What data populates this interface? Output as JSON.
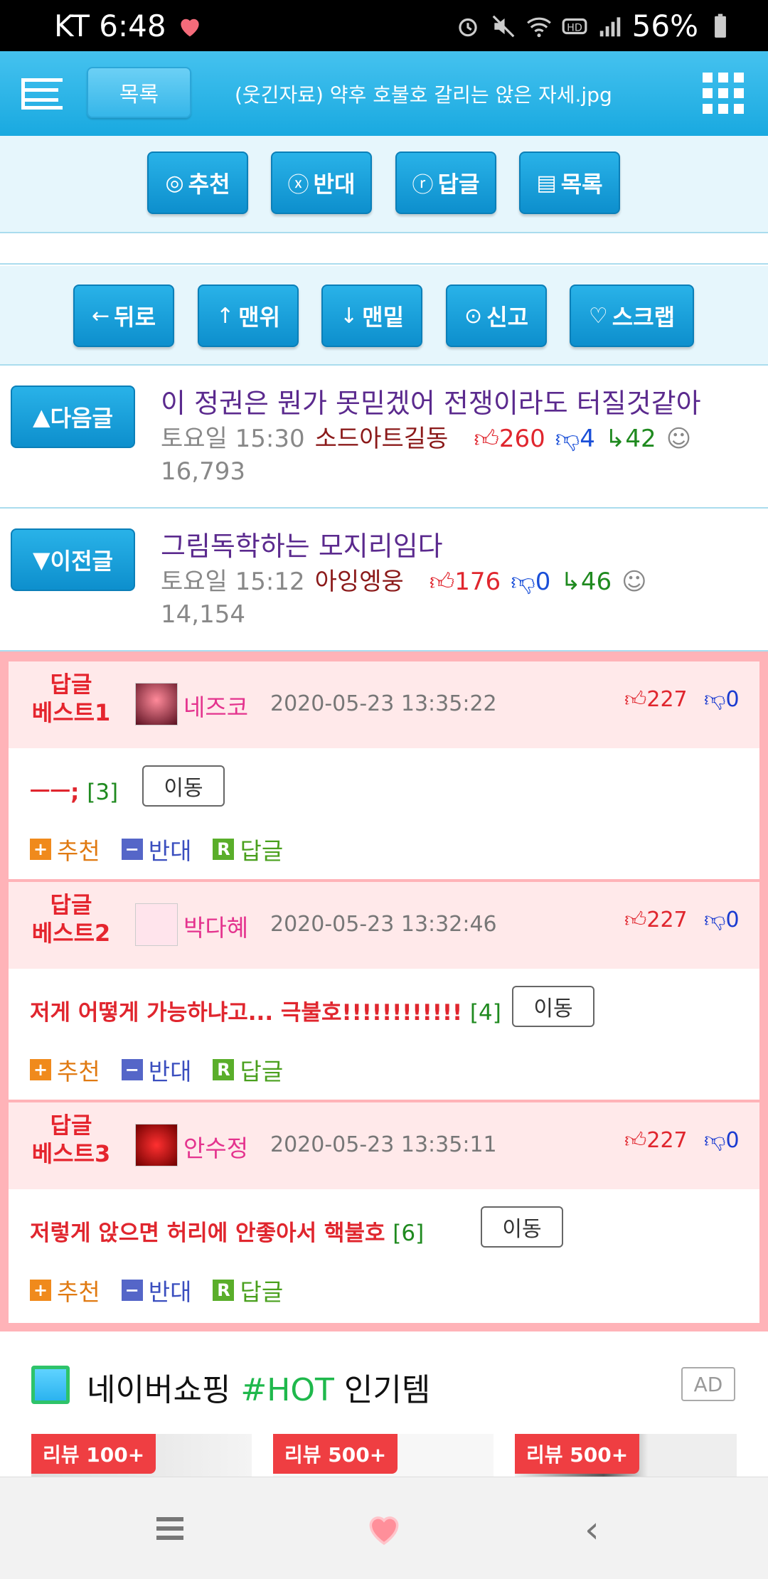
{
  "status_bar": {
    "carrier_time": "KT 6:48",
    "battery": "56%"
  },
  "header": {
    "list_button": "목록",
    "title": "(웃긴자료)  약후  호불호 갈리는 앉은 자세.jpg"
  },
  "toolbar1": {
    "recommend": "추천",
    "oppose": "반대",
    "reply": "답글",
    "list": "목록"
  },
  "toolbar2": {
    "back": "뒤로",
    "top": "맨위",
    "bottom": "맨밑",
    "report": "신고",
    "scrap": "스크랩"
  },
  "next_post": {
    "button": "다음글",
    "title": "이 정권은 뭔가 못믿겠어 전쟁이라도 터질것같아",
    "time": "토요일 15:30",
    "author": "소드아트길동",
    "up": "260",
    "down": "4",
    "replies": "42",
    "views": "16,793"
  },
  "prev_post": {
    "button": "이전글",
    "title": "그림독학하는 모지리임다",
    "time": "토요일 15:12",
    "author": "아잉엥웅",
    "up": "176",
    "down": "0",
    "replies": "46",
    "views": "14,154"
  },
  "best_replies": [
    {
      "label_top": "답글",
      "label_bottom": "베스트1",
      "name": "네즈코",
      "date": "2020-05-23 13:35:22",
      "up": "227",
      "down": "0",
      "text": "ㅡㅡ;",
      "count": "[3]",
      "move": "이동"
    },
    {
      "label_top": "답글",
      "label_bottom": "베스트2",
      "name": "박다혜",
      "date": "2020-05-23 13:32:46",
      "up": "227",
      "down": "0",
      "text": "저게 어떻게 가능하냐고... 극불호!!!!!!!!!!!!",
      "count": "[4]",
      "move": "이동"
    },
    {
      "label_top": "답글",
      "label_bottom": "베스트3",
      "name": "안수정",
      "date": "2020-05-23 13:35:11",
      "up": "227",
      "down": "0",
      "text": "저렇게 앉으면 허리에 안좋아서 핵불호",
      "count": "[6]",
      "move": "이동"
    }
  ],
  "reply_actions": {
    "recommend": "추천",
    "oppose": "반대",
    "reply": "답글"
  },
  "shopping": {
    "title_pre": "네이버쇼핑",
    "title_hot": "#HOT",
    "title_post": "인기템",
    "ad": "AD",
    "reviews": [
      "리뷰 100+",
      "리뷰 500+",
      "리뷰 500+"
    ]
  },
  "colors": {
    "header_blue": "#19a9e0",
    "best_red": "#e5252e",
    "best_bg": "#ffb3b8"
  }
}
